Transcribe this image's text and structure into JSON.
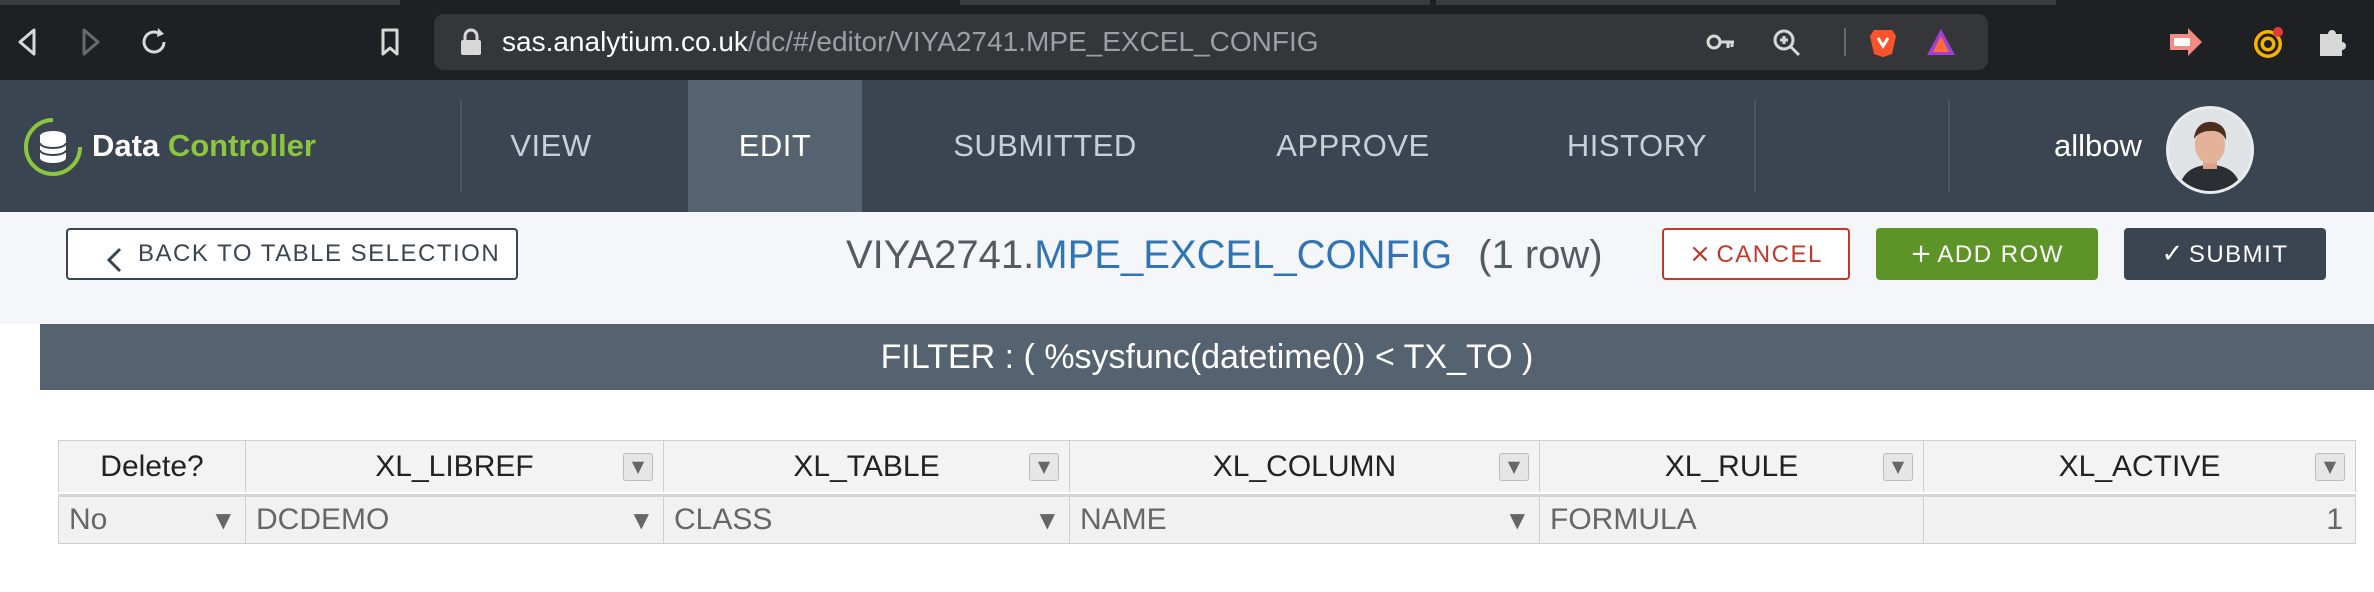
{
  "browser": {
    "url_host": "sas.analytium.co.uk",
    "url_path": "/dc/#/editor/VIYA2741.MPE_EXCEL_CONFIG",
    "icons": [
      "back-arrow-icon",
      "forward-arrow-icon",
      "reload-icon",
      "bookmark-icon",
      "lock-icon",
      "key-icon",
      "zoom-icon",
      "brave-shield-icon",
      "brave-rewards-icon",
      "extension-arrow-icon",
      "extension-spiral-icon",
      "puzzle-icon"
    ]
  },
  "header": {
    "logo_word1": "Data",
    "logo_word2": "Controller",
    "nav": [
      {
        "label": "VIEW",
        "active": false
      },
      {
        "label": "EDIT",
        "active": true
      },
      {
        "label": "SUBMITTED",
        "active": false
      },
      {
        "label": "APPROVE",
        "active": false
      },
      {
        "label": "HISTORY",
        "active": false
      }
    ],
    "username": "allbow",
    "colors": {
      "background": "#3a4551",
      "active_tab": "#556270",
      "accent": "#8cc63f"
    }
  },
  "toolbar": {
    "back_label": "BACK TO TABLE SELECTION",
    "title_lib": "VIYA2741.",
    "title_table": "MPE_EXCEL_CONFIG",
    "row_count": "(1 row)",
    "cancel_label": "CANCEL",
    "add_row_label": "ADD ROW",
    "submit_label": "SUBMIT"
  },
  "filter": {
    "text": "FILTER : ( %sysfunc(datetime()) < TX_TO )"
  },
  "grid": {
    "columns": [
      "Delete?",
      "XL_LIBREF",
      "XL_TABLE",
      "XL_COLUMN",
      "XL_RULE",
      "XL_ACTIVE"
    ],
    "rows": [
      [
        "No",
        "DCDEMO",
        "CLASS",
        "NAME",
        "FORMULA",
        "1"
      ]
    ]
  }
}
